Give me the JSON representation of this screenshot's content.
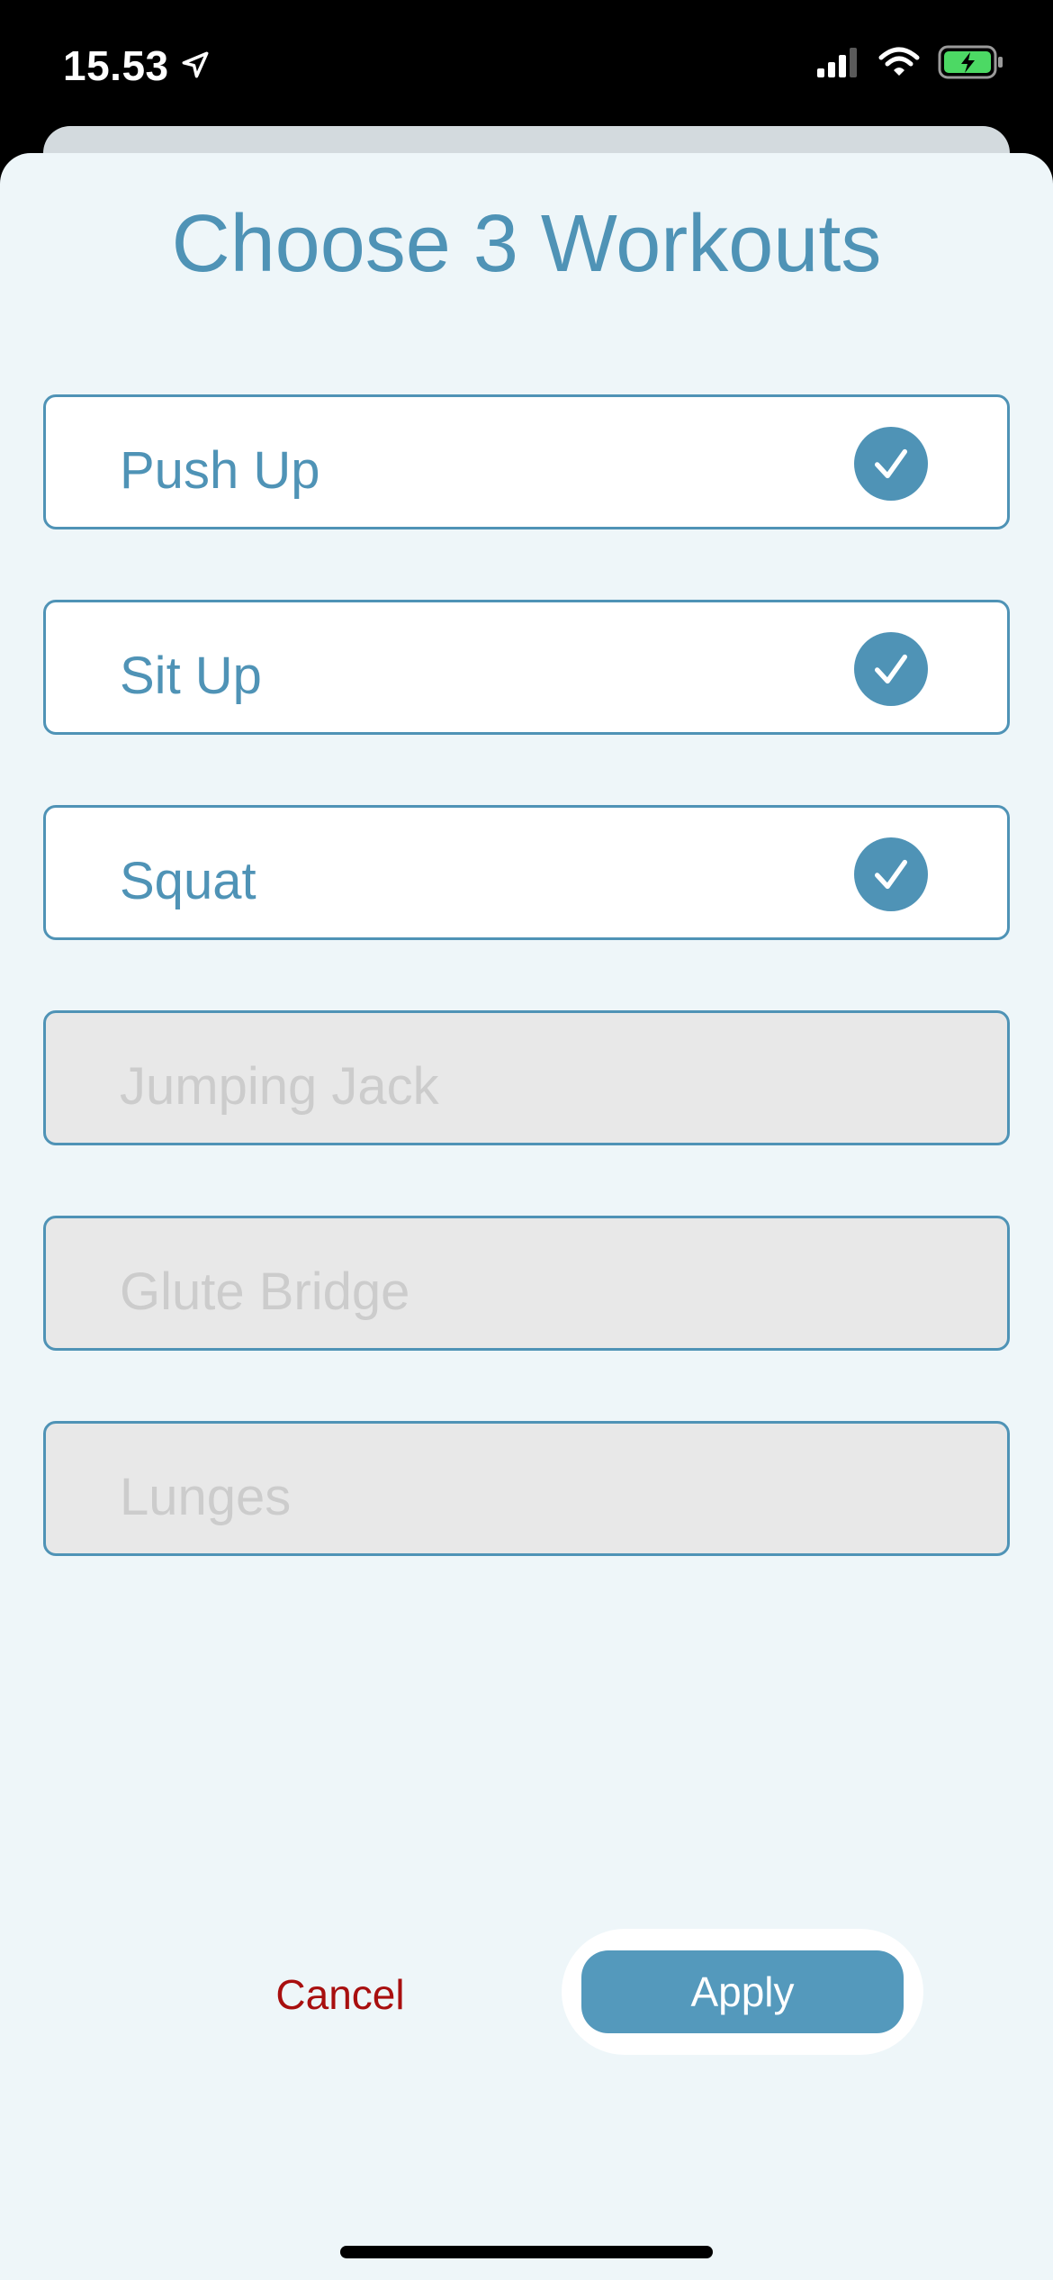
{
  "status_bar": {
    "time": "15.53",
    "icons": [
      "location-arrow-icon",
      "cellular-signal-icon",
      "wifi-icon",
      "battery-charging-icon"
    ],
    "battery_color": "#4cd964"
  },
  "sheet": {
    "title": "Choose 3 Workouts",
    "workouts": [
      {
        "label": "Push Up",
        "selected": true,
        "enabled": true
      },
      {
        "label": "Sit Up",
        "selected": true,
        "enabled": true
      },
      {
        "label": "Squat",
        "selected": true,
        "enabled": true
      },
      {
        "label": "Jumping Jack",
        "selected": false,
        "enabled": false
      },
      {
        "label": "Glute Bridge",
        "selected": false,
        "enabled": false
      },
      {
        "label": "Lunges",
        "selected": false,
        "enabled": false
      }
    ],
    "cancel_label": "Cancel",
    "apply_label": "Apply"
  },
  "colors": {
    "accent": "#4f93b6",
    "cancel": "#a80f0f",
    "sheet_background": "#eef6f9",
    "disabled_background": "#e8e8e8"
  }
}
